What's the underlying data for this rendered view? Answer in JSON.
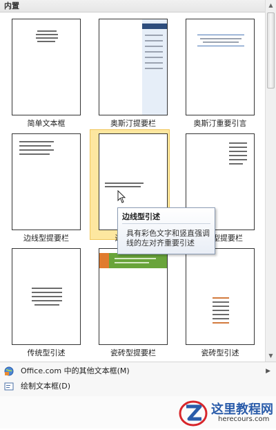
{
  "section": {
    "title": "内置"
  },
  "gallery": {
    "items": [
      {
        "caption": "简单文本框"
      },
      {
        "caption": "奥斯汀提要栏"
      },
      {
        "caption": "奥斯汀重要引言"
      },
      {
        "caption": "边线型提要栏"
      },
      {
        "caption": "边线型引述"
      },
      {
        "caption": "边线型提要栏"
      },
      {
        "caption": "传统型引述"
      },
      {
        "caption": "瓷砖型提要栏"
      },
      {
        "caption": "瓷砖型引述"
      }
    ],
    "selected_index": 4
  },
  "tooltip": {
    "title": "边线型引述",
    "body": "具有彩色文字和竖直强调线的左对齐重要引述"
  },
  "menu": {
    "items": [
      {
        "label": "Office.com 中的其他文本框(M)",
        "icon": "office-globe-icon",
        "has_submenu": true
      },
      {
        "label": "绘制文本框(D)",
        "icon": "draw-textbox-icon",
        "has_submenu": false
      }
    ]
  },
  "watermark": {
    "text_cn": "这里教程网",
    "text_en": "herecours.com"
  },
  "colors": {
    "selection": "#fde7a0",
    "accent_blue": "#4b78b8",
    "accent_green": "#69a43a",
    "accent_orange": "#e07b2e"
  }
}
